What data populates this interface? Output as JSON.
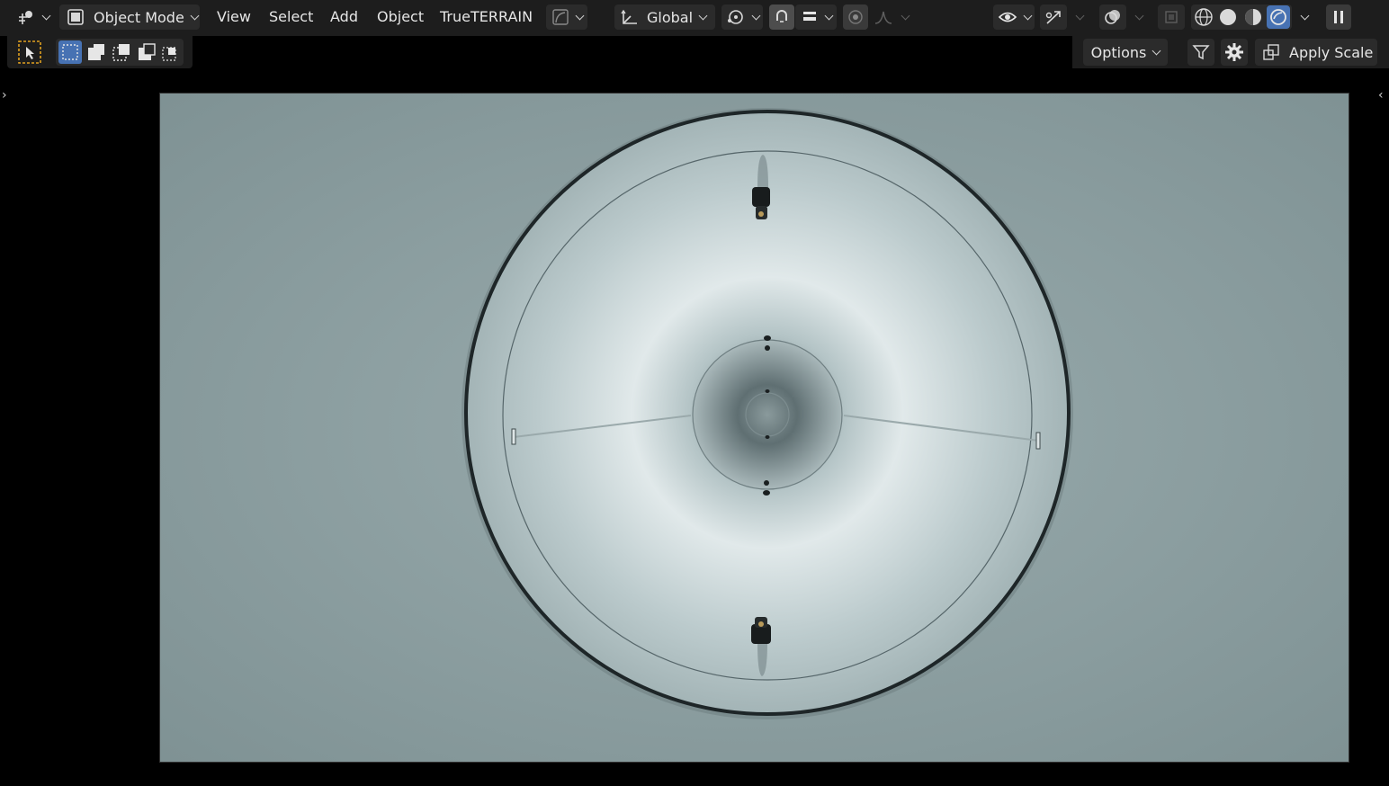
{
  "header": {
    "mode_label": "Object Mode",
    "menus": [
      "View",
      "Select",
      "Add",
      "Object",
      "TrueTERRAIN"
    ],
    "orientation_label": "Global"
  },
  "toolbar_right": {
    "options_label": "Options",
    "apply_scale_label": "Apply Scale"
  },
  "icons": {
    "editor_type": "editor-type-icon",
    "mode": "object-mode-icon",
    "orientation": "transform-orientation-icon",
    "pivot": "pivot-point-icon",
    "snap": "snap-magnet-icon",
    "proportional": "proportional-editing-icon",
    "visibility": "eye-selectability-icon",
    "gizmo": "gizmo-icon",
    "overlays": "overlays-icon",
    "xray": "xray-icon",
    "shading_wire": "wireframe-shading-icon",
    "shading_solid": "solid-shading-icon",
    "shading_material": "material-preview-icon",
    "shading_rendered": "rendered-shading-icon",
    "pause": "pause-icon",
    "filter": "filter-icon",
    "settings": "gear-icon"
  },
  "colors": {
    "header_bg": "#1d1d1d",
    "active_blue": "#4772b3",
    "select_orange": "#e0a020",
    "viewport_bg": "#8c9ea0"
  },
  "viewport": {
    "content": "camera view of a circular dish with two mounts"
  }
}
